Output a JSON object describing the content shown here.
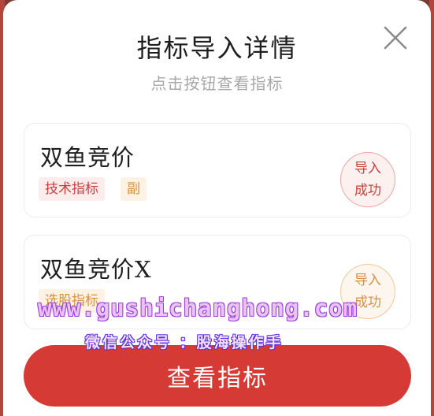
{
  "dialog": {
    "title": "指标导入详情",
    "subtitle": "点击按钮查看指标",
    "close_icon": "close-icon"
  },
  "items": [
    {
      "name": "双鱼竞价",
      "tags": [
        "技术指标",
        "副"
      ],
      "status": "导入成功",
      "status_lines": [
        "导入",
        "成功"
      ],
      "status_color": "#c8413d"
    },
    {
      "name": "双鱼竞价X",
      "tags": [
        "选股指标"
      ],
      "status": "导入成功",
      "status_lines": [
        "导入",
        "成功"
      ],
      "status_color": "#d79043"
    }
  ],
  "action": {
    "label": "查看指标",
    "color": "#d63a35"
  },
  "watermark": {
    "url": "www.gushichanghong.com",
    "wechat": "微信公众号 ：股海操作手"
  }
}
